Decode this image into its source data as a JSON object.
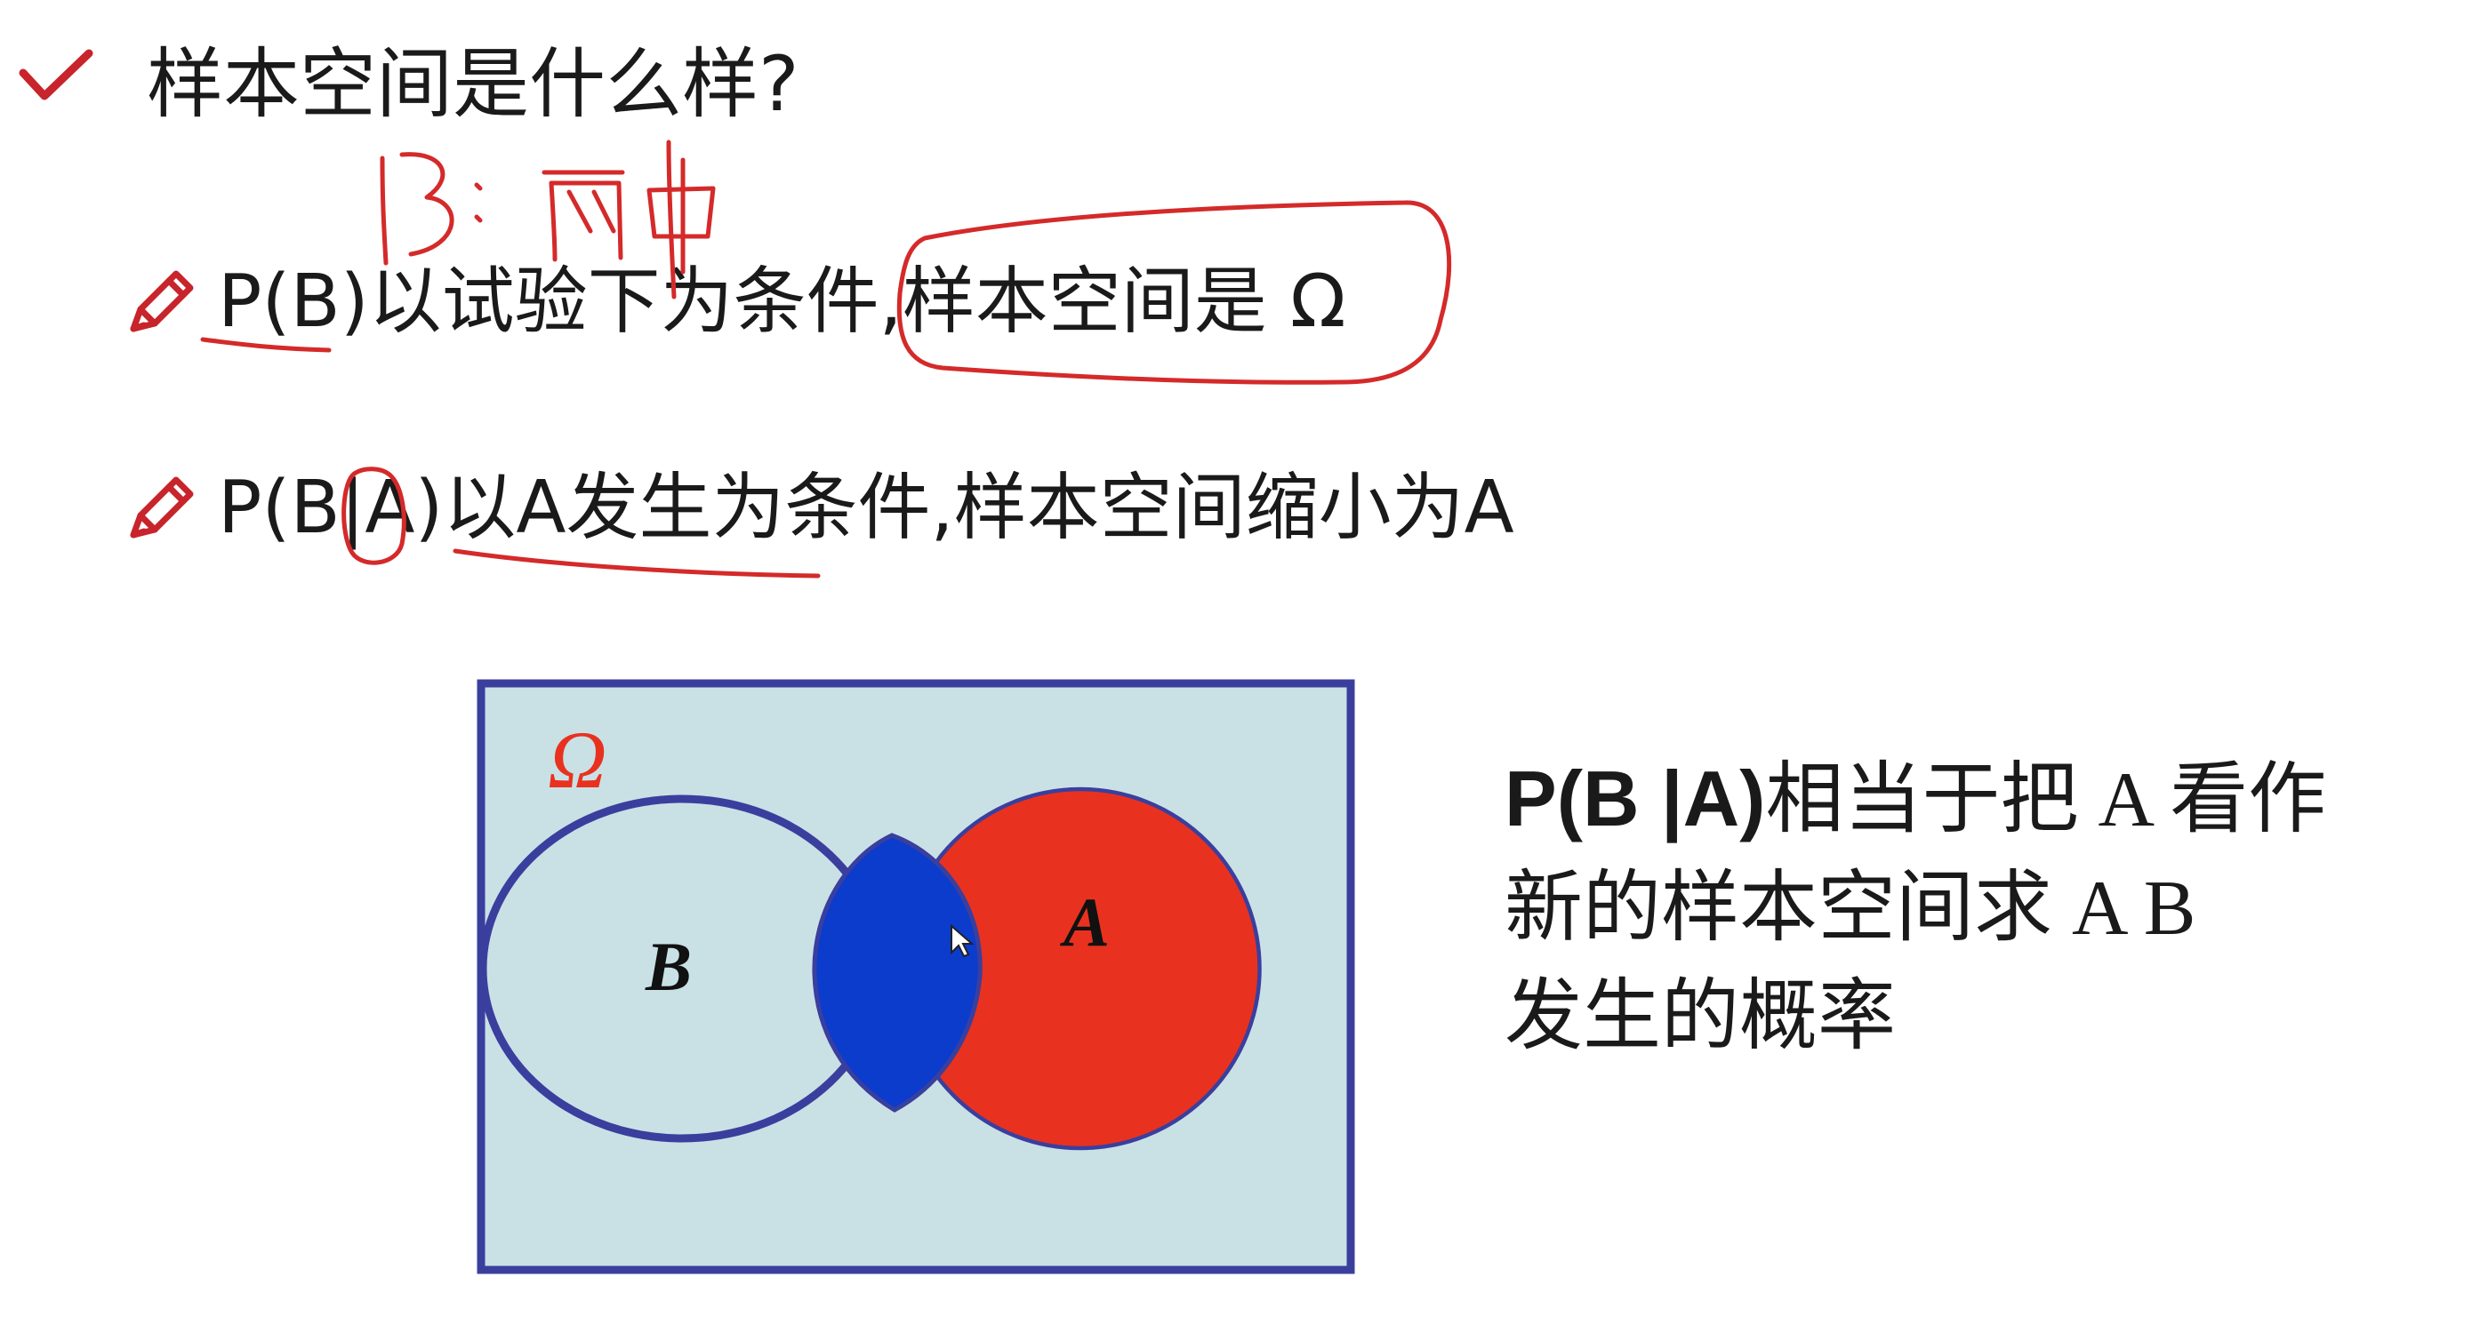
{
  "heading": {
    "title": "样本空间是什么样?"
  },
  "bullets": [
    {
      "text": "P(B)以试验下为条件,样本空间是 Ω"
    },
    {
      "text": "P(B|A)以A发生为条件,样本空间缩小为A"
    }
  ],
  "handwriting": {
    "note": "B:两中"
  },
  "venn": {
    "omega_label": "Ω",
    "set_b_label": "B",
    "set_a_label": "A",
    "colors": {
      "background": "#c9e1e5",
      "border": "#3a3f9e",
      "set_a_fill": "#e8321f",
      "intersection_fill": "#0b3ccc",
      "omega_color": "#e8321f"
    }
  },
  "side_note": {
    "bold": "P(B |A)",
    "line1_rest": "相当于把 A 看作",
    "line2": "新的样本空间求 A B",
    "line3": "发生的概率"
  },
  "annotation_color": "#d42a2a"
}
